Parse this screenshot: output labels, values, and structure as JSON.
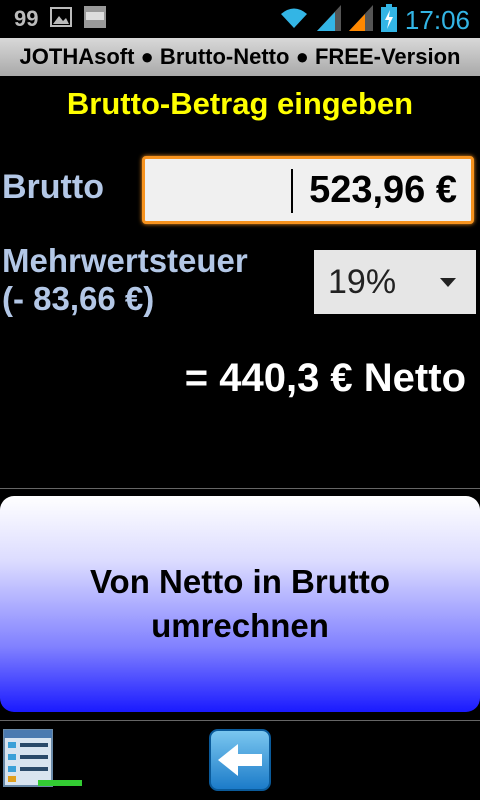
{
  "status_bar": {
    "notification_count": "99",
    "time": "17:06",
    "icons": [
      "image-icon",
      "basic4android-icon",
      "wifi-icon",
      "signal-icon",
      "signal-icon",
      "battery-charging-icon"
    ]
  },
  "app_title": "JOTHAsoft ● Brutto-Netto ● FREE-Version",
  "heading": "Brutto-Betrag eingeben",
  "brutto": {
    "label": "Brutto",
    "value": "523,96 €"
  },
  "mwst": {
    "label": "Mehrwertsteuer",
    "amount": "(- 83,66 €)",
    "selected": "19%"
  },
  "result": "= 440,3 € Netto",
  "convert_button": {
    "line1": "Von Netto in Brutto",
    "line2": "umrechnen"
  },
  "bottom_bar": {
    "icons": [
      "list-icon",
      "back-arrow-icon"
    ]
  },
  "colors": {
    "heading": "#ffff00",
    "label": "#b3c7e6",
    "input_border": "#f7931e",
    "time": "#33b5e5",
    "button_bottom": "#1a1aff"
  }
}
